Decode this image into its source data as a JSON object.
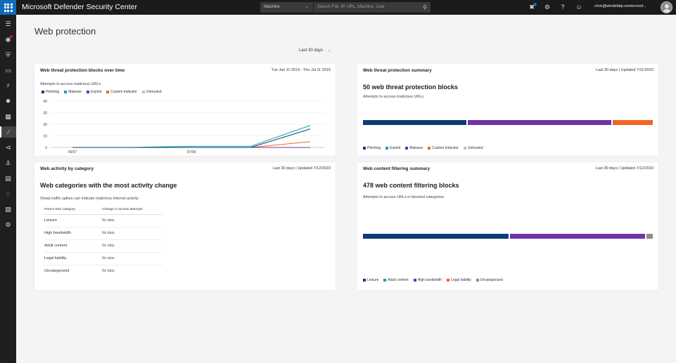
{
  "app": {
    "title": "Microsoft Defender Security Center",
    "scope_label": "Machine",
    "search_placeholder": "Search File, IP, URL, Machine, User",
    "user_email": "chris@windefatp.onmicrosof..."
  },
  "page": {
    "title": "Web protection",
    "date_filter": "Last 30 days"
  },
  "cards": {
    "blocks_over_time": {
      "title": "Web threat protection blocks over time",
      "meta": "Tue Jun 11 2019 - Thu Jul 11 2019",
      "chart_data": {
        "type": "line",
        "title": "Attempts to access malicious URLs",
        "xlabel": "",
        "ylabel": "",
        "x": [
          "06/07",
          "",
          "07/08",
          "",
          ""
        ],
        "x_ticks": [
          "06/07",
          "07/08"
        ],
        "ylim": [
          0,
          40
        ],
        "y_ticks": [
          "0",
          "10",
          "20",
          "30",
          "40"
        ],
        "legend_position": "top",
        "series": [
          {
            "name": "Phishing",
            "color": "#0b3d70",
            "values": [
              0,
              0,
              0,
              0,
              16
            ]
          },
          {
            "name": "Malware",
            "color": "#00a3b4",
            "values": [
              0,
              0,
              1,
              1,
              19
            ]
          },
          {
            "name": "Exploit",
            "color": "#6d33a8",
            "values": [
              0,
              0,
              0,
              0,
              0
            ]
          },
          {
            "name": "Custom Indicator",
            "color": "#f26522",
            "values": [
              0,
              0,
              0,
              0,
              5
            ]
          },
          {
            "name": "Untrusted",
            "color": "#bfbfbf",
            "values": [
              0,
              0,
              0,
              0,
              0
            ]
          }
        ]
      }
    },
    "summary": {
      "title": "Web threat protection summary",
      "meta": "Last 30 days | Updated 7/11/2019",
      "headline": "50 web threat protection blocks",
      "subtext": "Attempts to access malicious URLs",
      "chart_data": {
        "type": "bar",
        "orientation": "horizontal-stacked",
        "categories": [
          "Phishing",
          "Exploit",
          "Malware",
          "Custom Indicator",
          "Untrusted"
        ],
        "values": [
          18,
          0,
          25,
          7,
          0
        ],
        "colors": [
          "#0b3d70",
          "#00a3b4",
          "#6d33a8",
          "#f26522",
          "#bfbfbf"
        ]
      }
    },
    "activity": {
      "title": "Web activity by category",
      "meta": "Last 30 days | Updated 7/12/2019",
      "headline": "Web categories with the most activity change",
      "subtext": "Sharp traffic spikes can indicate malicious internal activity",
      "table": {
        "headers": [
          "Parent web category",
          "Change in access attempts"
        ],
        "rows": [
          [
            "Leisure",
            "No data"
          ],
          [
            "High bandwidth",
            "No data"
          ],
          [
            "Adult content",
            "No data"
          ],
          [
            "Legal liability",
            "No data"
          ],
          [
            "Uncategorized",
            "No data"
          ]
        ]
      }
    },
    "filtering": {
      "title": "Web content filtering summary",
      "meta": "Last 30 days | Updated 7/12/2019",
      "headline": "478 web content filtering blocks",
      "subtext": "Attempts to access URLs in blocked categories",
      "chart_data": {
        "type": "bar",
        "orientation": "horizontal-stacked",
        "categories": [
          "Leisure",
          "Adult content",
          "High bandwidth",
          "Legal liability",
          "Uncategorized"
        ],
        "values": [
          242,
          0,
          226,
          0,
          10
        ],
        "colors": [
          "#0b3d70",
          "#00a3b4",
          "#6d33a8",
          "#f26522",
          "#8c8c8c"
        ]
      }
    }
  },
  "icons": {
    "waffle": "app-launcher-icon",
    "nav": [
      "hamburger-icon",
      "dashboard-alert-icon",
      "shield-icon",
      "machine-icon",
      "lightning-icon",
      "settings-gear-icon",
      "database-icon",
      "reports-chart-icon",
      "partners-icon",
      "evaluation-icon",
      "devices-icon",
      "diamond-icon",
      "computer-config-icon",
      "gear-icon"
    ]
  }
}
